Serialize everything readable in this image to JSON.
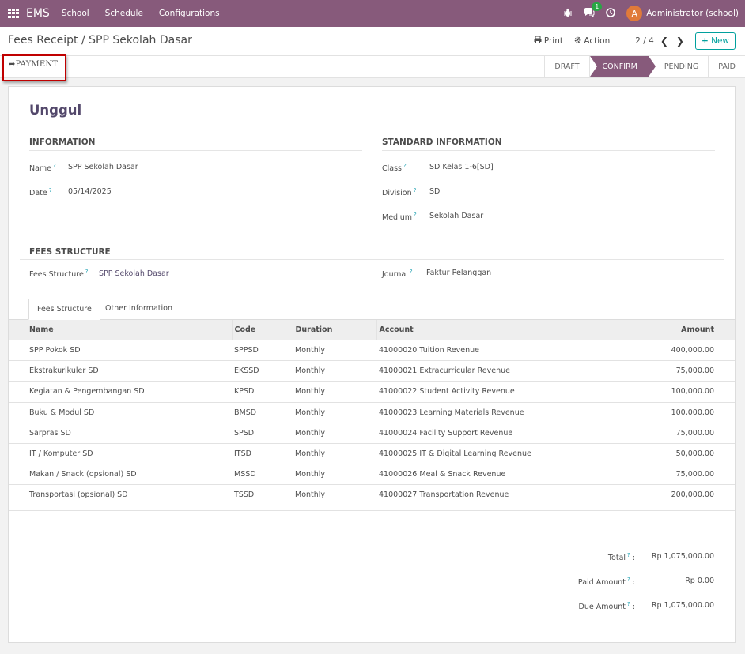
{
  "navbar": {
    "brand": "EMS",
    "menu": [
      "School",
      "Schedule",
      "Configurations"
    ],
    "chat_badge": "1",
    "avatar_letter": "A",
    "user": "Administrator (school)"
  },
  "control_panel": {
    "breadcrumb": "Fees Receipt / SPP Sekolah Dasar",
    "print_label": "Print",
    "action_label": "Action",
    "pager": "2 / 4",
    "new_label": "New"
  },
  "statusbar": {
    "payment_label": "PAYMENT",
    "stages": [
      "DRAFT",
      "CONFIRM",
      "PENDING",
      "PAID"
    ],
    "active_stage": "CONFIRM"
  },
  "form": {
    "title": "Unggul",
    "information": {
      "heading": "INFORMATION",
      "name_label": "Name",
      "name_value": "SPP Sekolah Dasar",
      "date_label": "Date",
      "date_value": "05/14/2025"
    },
    "standard": {
      "heading": "STANDARD INFORMATION",
      "class_label": "Class",
      "class_value": "SD Kelas 1-6[SD]",
      "division_label": "Division",
      "division_value": "SD",
      "medium_label": "Medium",
      "medium_value": "Sekolah Dasar"
    },
    "fees": {
      "heading": "FEES STRUCTURE",
      "structure_label": "Fees Structure",
      "structure_value": "SPP Sekolah Dasar",
      "journal_label": "Journal",
      "journal_value": "Faktur Pelanggan"
    },
    "tabs": [
      "Fees Structure",
      "Other Information"
    ],
    "table": {
      "headers": [
        "Name",
        "Code",
        "Duration",
        "Account",
        "Amount"
      ],
      "rows": [
        [
          "SPP Pokok SD",
          "SPPSD",
          "Monthly",
          "41000020 Tuition Revenue",
          "400,000.00"
        ],
        [
          "Ekstrakurikuler SD",
          "EKSSD",
          "Monthly",
          "41000021 Extracurricular Revenue",
          "75,000.00"
        ],
        [
          "Kegiatan & Pengembangan SD",
          "KPSD",
          "Monthly",
          "41000022 Student Activity Revenue",
          "100,000.00"
        ],
        [
          "Buku & Modul SD",
          "BMSD",
          "Monthly",
          "41000023 Learning Materials Revenue",
          "100,000.00"
        ],
        [
          "Sarpras SD",
          "SPSD",
          "Monthly",
          "41000024 Facility Support Revenue",
          "75,000.00"
        ],
        [
          "IT / Komputer SD",
          "ITSD",
          "Monthly",
          "41000025 IT & Digital Learning Revenue",
          "50,000.00"
        ],
        [
          "Makan / Snack (opsional) SD",
          "MSSD",
          "Monthly",
          "41000026 Meal & Snack Revenue",
          "75,000.00"
        ],
        [
          "Transportasi (opsional) SD",
          "TSSD",
          "Monthly",
          "41000027 Transportation Revenue",
          "200,000.00"
        ]
      ]
    },
    "totals": {
      "total_label": "Total",
      "total_value": "Rp 1,075,000.00",
      "paid_label": "Paid Amount",
      "paid_value": "Rp 0.00",
      "due_label": "Due Amount",
      "due_value": "Rp 1,075,000.00"
    }
  },
  "colors": {
    "brand": "#875a7b",
    "title": "#53486b",
    "new_button": "#00a09d",
    "highlight": "#c00000"
  }
}
